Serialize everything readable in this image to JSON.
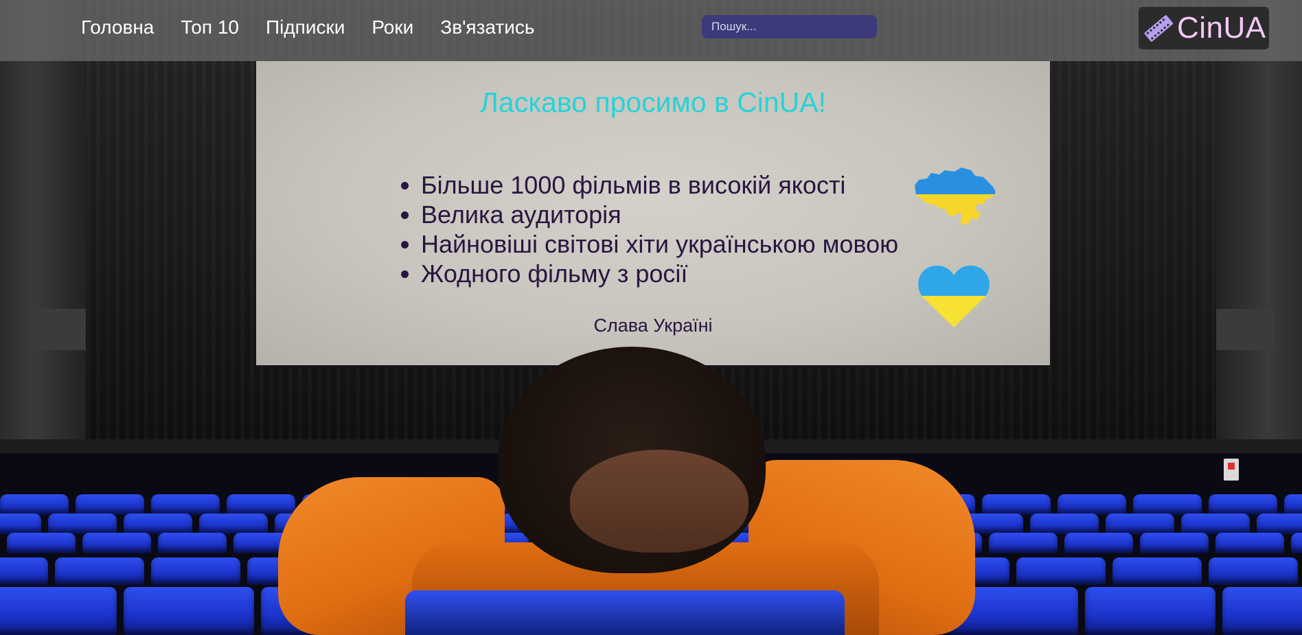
{
  "header": {
    "nav": [
      {
        "label": "Головна"
      },
      {
        "label": "Топ 10"
      },
      {
        "label": "Підписки"
      },
      {
        "label": "Роки"
      },
      {
        "label": "Зв'язатись"
      }
    ],
    "search": {
      "placeholder": "Пошук...",
      "value": ""
    },
    "logo": {
      "text": "CinUA",
      "icon": "film-strip-icon"
    }
  },
  "screen": {
    "title": "Ласкаво просимо в CinUA!",
    "features": [
      "Більше 1000 фільмів в високій якості",
      "Велика аудиторія",
      "Найновіші світові хіти українською мовою",
      "Жодного фільму з росії"
    ],
    "slogan": "Слава Україні",
    "icons": [
      "ukraine-map-icon",
      "ukraine-heart-icon"
    ]
  },
  "colors": {
    "title": "#27d3d8",
    "text": "#2a1440",
    "search_bg": "#3c3a7a",
    "flag_blue": "#2a8fe0",
    "flag_yellow": "#f7d62a",
    "logo_text": "#f3c8f5"
  },
  "background": "cinema-hall-photo"
}
